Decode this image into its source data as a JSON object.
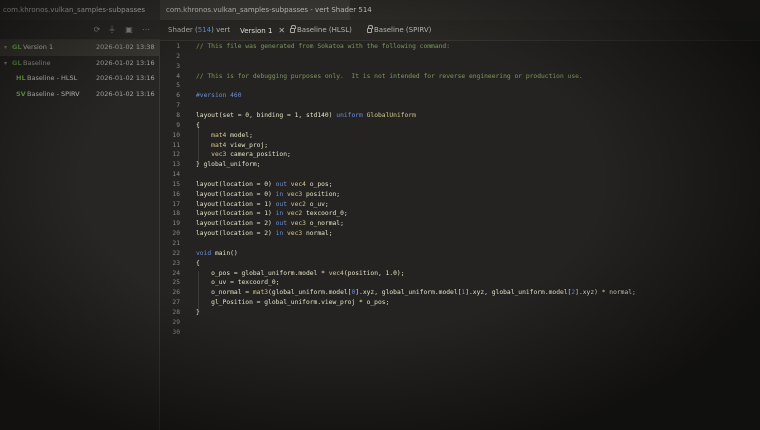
{
  "left_panel": {
    "title": "com.khronos.vulkan_samples-subpasses",
    "toolbar_icons": [
      "refresh-icon",
      "filter-icon",
      "export-icon",
      "more-icon"
    ],
    "tree": [
      {
        "caret": "▾",
        "tag": "GL",
        "name": "Version 1",
        "date": "2026-01-02 13:38",
        "selected": true
      },
      {
        "caret": "▾",
        "tag": "GL",
        "name": "Baseline",
        "date": "2026-01-02 13:16",
        "selected": false
      },
      {
        "caret": "",
        "tag": "HL",
        "name": "Baseline - HLSL",
        "date": "2026-01-02 13:16",
        "selected": false
      },
      {
        "caret": "",
        "tag": "SV",
        "name": "Baseline - SPIRV",
        "date": "2026-01-02 13:16",
        "selected": false
      }
    ]
  },
  "editor": {
    "doc_tab": "com.khronos.vulkan_samples-subpasses - vert Shader 514",
    "sub_tabs": {
      "shader_prefix": "Shader (",
      "shader_id": "514",
      "shader_suffix": ") vert",
      "version": "Version 1",
      "close_glyph": "✕",
      "baseline_hlsl": "Baseline (HLSL)",
      "baseline_spirv": "Baseline (SPIRV)"
    },
    "code_lines": [
      {
        "n": "1",
        "segs": [
          [
            "c",
            "// This file was generated from Sokatoa with the following command:"
          ]
        ]
      },
      {
        "n": "2",
        "segs": []
      },
      {
        "n": "3",
        "segs": []
      },
      {
        "n": "4",
        "segs": [
          [
            "c",
            "// This is for debugging purposes only.  It is not intended for reverse engineering or production use."
          ]
        ]
      },
      {
        "n": "5",
        "segs": []
      },
      {
        "n": "6",
        "segs": [
          [
            "b",
            "#version 460"
          ]
        ]
      },
      {
        "n": "7",
        "segs": []
      },
      {
        "n": "8",
        "segs": [
          [
            "p",
            "layout(set = 0, binding = 1, std140) "
          ],
          [
            "b",
            "uniform"
          ],
          [
            "t",
            " GlobalUniform"
          ]
        ]
      },
      {
        "n": "9",
        "segs": [
          [
            "p",
            "{"
          ]
        ]
      },
      {
        "n": "10",
        "segs": [
          [
            "p",
            "    "
          ],
          [
            "t",
            "mat4"
          ],
          [
            "p",
            " model;"
          ]
        ]
      },
      {
        "n": "11",
        "segs": [
          [
            "p",
            "    "
          ],
          [
            "t",
            "mat4"
          ],
          [
            "p",
            " view_proj;"
          ]
        ]
      },
      {
        "n": "12",
        "segs": [
          [
            "p",
            "    "
          ],
          [
            "t",
            "vec3"
          ],
          [
            "p",
            " camera_position;"
          ]
        ]
      },
      {
        "n": "13",
        "segs": [
          [
            "p",
            "} global_uniform;"
          ]
        ]
      },
      {
        "n": "14",
        "segs": []
      },
      {
        "n": "15",
        "segs": [
          [
            "p",
            "layout(location = 0) "
          ],
          [
            "b",
            "out"
          ],
          [
            "t",
            " vec4"
          ],
          [
            "p",
            " o_pos;"
          ]
        ]
      },
      {
        "n": "16",
        "segs": [
          [
            "p",
            "layout(location = 0) "
          ],
          [
            "b",
            "in"
          ],
          [
            "t",
            " vec3"
          ],
          [
            "p",
            " position;"
          ]
        ]
      },
      {
        "n": "17",
        "segs": [
          [
            "p",
            "layout(location = 1) "
          ],
          [
            "b",
            "out"
          ],
          [
            "t",
            " vec2"
          ],
          [
            "p",
            " o_uv;"
          ]
        ]
      },
      {
        "n": "18",
        "segs": [
          [
            "p",
            "layout(location = 1) "
          ],
          [
            "b",
            "in"
          ],
          [
            "t",
            " vec2"
          ],
          [
            "p",
            " texcoord_0;"
          ]
        ]
      },
      {
        "n": "19",
        "segs": [
          [
            "p",
            "layout(location = 2) "
          ],
          [
            "b",
            "out"
          ],
          [
            "t",
            " vec3"
          ],
          [
            "p",
            " o_normal;"
          ]
        ]
      },
      {
        "n": "20",
        "segs": [
          [
            "p",
            "layout(location = 2) "
          ],
          [
            "b",
            "in"
          ],
          [
            "t",
            " vec3"
          ],
          [
            "p",
            " normal;"
          ]
        ]
      },
      {
        "n": "21",
        "segs": []
      },
      {
        "n": "22",
        "segs": [
          [
            "k",
            "void"
          ],
          [
            "p",
            " main()"
          ]
        ]
      },
      {
        "n": "23",
        "segs": [
          [
            "p",
            "{"
          ]
        ]
      },
      {
        "n": "24",
        "segs": [
          [
            "p",
            "    o_pos = global_uniform.model * "
          ],
          [
            "t",
            "vec4"
          ],
          [
            "p",
            "(position, 1.0);"
          ]
        ]
      },
      {
        "n": "25",
        "segs": [
          [
            "p",
            "    o_uv = texcoord_0;"
          ]
        ]
      },
      {
        "n": "26",
        "segs": [
          [
            "p",
            "    o_normal = "
          ],
          [
            "t",
            "mat3"
          ],
          [
            "p",
            "(global_uniform.model["
          ],
          [
            "b",
            "0"
          ],
          [
            "p",
            "].xyz, global_uniform.model["
          ],
          [
            "b",
            "1"
          ],
          [
            "p",
            "].xyz, global_uniform.model["
          ],
          [
            "b",
            "2"
          ],
          [
            "p",
            "].xyz) * normal;"
          ]
        ]
      },
      {
        "n": "27",
        "segs": [
          [
            "p",
            "    gl_Position = global_uniform.view_proj * o_pos;"
          ]
        ]
      },
      {
        "n": "28",
        "segs": [
          [
            "p",
            "}"
          ]
        ]
      },
      {
        "n": "29",
        "segs": []
      },
      {
        "n": "30",
        "segs": []
      }
    ]
  },
  "colors": {
    "comment": "#7d9a5c",
    "keyword_blue": "#6a8fd8",
    "type": "#d6c98a",
    "tag_green": "#6fb04d"
  }
}
